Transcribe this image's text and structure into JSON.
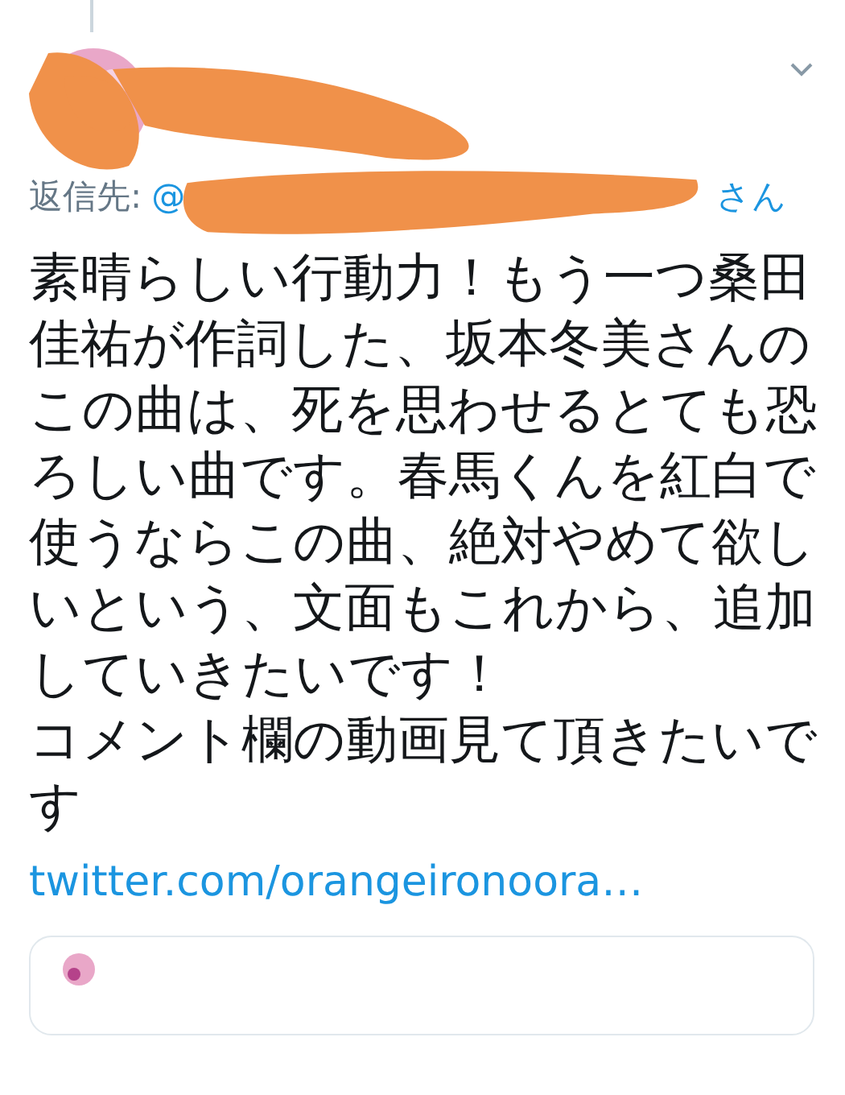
{
  "tweet": {
    "reply_label": "返信先:",
    "reply_lead": "@",
    "reply_tail": "さん",
    "paragraphs": [
      "素晴らしい行動力！もう一つ桑田佳祐が作詞した、坂本冬美さんのこの曲は、死を思わせるとても恐ろしい曲です。春馬くんを紅白で使うならこの曲、絶対やめて欲しいという、文面もこれから、追加していきたいです！",
      "コメント欄の動画見て頂きたいです"
    ],
    "link": "twitter.com/orangeironoora…"
  }
}
